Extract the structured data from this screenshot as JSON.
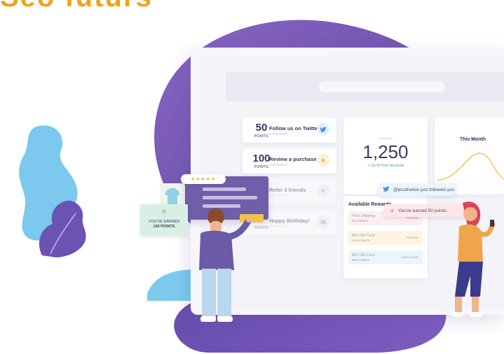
{
  "heading_fragment": "Seo futurs",
  "tasks": [
    {
      "points": "50",
      "points_label": "POINTS",
      "title": "Follow us on Twitter",
      "icon": "twitter-icon",
      "icon_glyph": "🐦"
    },
    {
      "points": "100",
      "points_label": "POINTS",
      "title": "Review a purchase",
      "icon": "star-icon",
      "icon_glyph": "★"
    },
    {
      "points": "",
      "points_label": "",
      "title": "Refer 3 friends",
      "icon": "heart-icon",
      "icon_glyph": "♥"
    },
    {
      "points": "",
      "points_label": "POINTS",
      "title": "Happy Birthday!",
      "icon": "gift-icon",
      "icon_glyph": "🎁"
    }
  ],
  "points_balance": {
    "value": "1,250",
    "trend": "↗ Up 50 from last week"
  },
  "month_panel": {
    "title": "This Month"
  },
  "rewards": {
    "title": "Available Rewards",
    "items": [
      {
        "name": "Free shipping",
        "sub": "300 POINTS",
        "action": "REDEEM"
      },
      {
        "name": "$10 Gift Card",
        "sub": "1000 POINTS",
        "action": "REDEEM"
      },
      {
        "name": "$50 Gift Card",
        "sub": "5000 POINTS",
        "action": "EARN MORE"
      }
    ]
  },
  "notifications": {
    "follow": "@jessthelion just followed you",
    "earned": "You've earned 50 points"
  },
  "toast": {
    "line1": "YOU'VE EARNED",
    "line2": "100 POINTS"
  },
  "stars": "★★★★★",
  "colors": {
    "purple": "#6f5ea8",
    "blob_purple": "#7a5cb3",
    "light_blue": "#6fc4ec",
    "accent_yellow": "#f3c24a",
    "twitter_blue": "#4a90d9",
    "green_trend": "#3fae5a"
  }
}
